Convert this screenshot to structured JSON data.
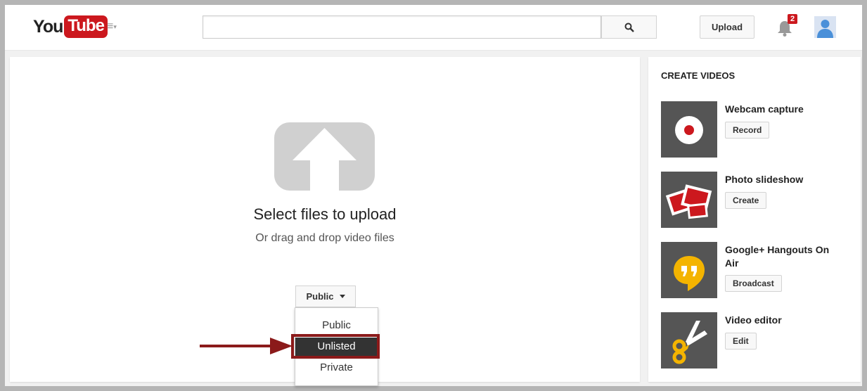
{
  "header": {
    "logo_you": "You",
    "logo_tube": "Tube",
    "search_placeholder": "",
    "upload_label": "Upload",
    "notification_count": "2"
  },
  "upload": {
    "title": "Select files to upload",
    "subtitle": "Or drag and drop video files",
    "privacy_selected": "Public",
    "privacy_options": [
      "Public",
      "Unlisted",
      "Private"
    ],
    "highlighted_option": "Unlisted"
  },
  "sidebar": {
    "title": "CREATE VIDEOS",
    "tools": [
      {
        "title": "Webcam capture",
        "button": "Record",
        "icon": "record-icon"
      },
      {
        "title": "Photo slideshow",
        "button": "Create",
        "icon": "photos-icon"
      },
      {
        "title": "Google+ Hangouts On Air",
        "button": "Broadcast",
        "icon": "hangouts-icon"
      },
      {
        "title": "Video editor",
        "button": "Edit",
        "icon": "scissors-icon"
      }
    ]
  },
  "colors": {
    "brand_red": "#cc181e",
    "highlight": "#8b1a1a",
    "thumb_bg": "#555555",
    "hangouts_yellow": "#f4b400"
  }
}
